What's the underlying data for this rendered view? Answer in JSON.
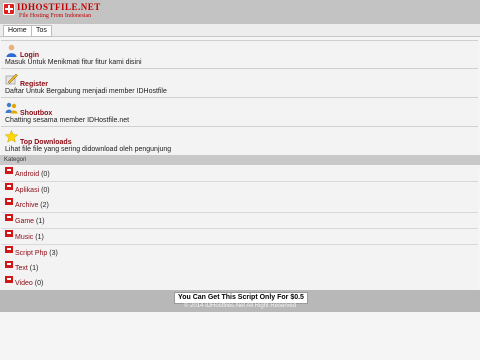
{
  "header": {
    "brand": "IDHOSTFILE.NET",
    "tagline": "File Hosting From Indonesian",
    "logo_icon": "red-plus-badge-icon"
  },
  "nav": {
    "tabs": [
      {
        "label": "Home"
      },
      {
        "label": "Tos"
      }
    ]
  },
  "features": [
    {
      "title": "Login",
      "desc": "Masuk Untuk Menikmati fitur fitur kami disini",
      "icon": "user-icon"
    },
    {
      "title": "Register",
      "desc": "Daftar Untuk Bergabung menjadi member IDHostfile",
      "icon": "register-pencil-icon"
    },
    {
      "title": "Shoutbox",
      "desc": "Chatting sesama member IDHostfile.net",
      "icon": "chat-users-icon"
    },
    {
      "title": "Top Downloads",
      "desc": "Lihat file file yang sering didownload oleh pengunjung",
      "icon": "star-icon"
    }
  ],
  "categories": {
    "heading": "Kategori",
    "items": [
      {
        "label": "Android",
        "count": "(0)"
      },
      {
        "label": "Aplikasi",
        "count": "(0)"
      },
      {
        "label": "Archive",
        "count": "(2)"
      },
      {
        "label": "Game",
        "count": "(1)"
      },
      {
        "label": "Music",
        "count": "(1)"
      },
      {
        "label": "Script Php",
        "count": "(3)"
      },
      {
        "label": "Text",
        "count": "(1)"
      },
      {
        "label": "Video",
        "count": "(0)"
      }
    ]
  },
  "footer": {
    "promo": "You Can Get This Script Only For $0.5",
    "copyright": "© 2014 IDHostfiles.Net All Right Reserved"
  },
  "colors": {
    "accent": "#8b0a14",
    "brand_red": "#c00000",
    "header_bg": "#c3c3c3"
  }
}
